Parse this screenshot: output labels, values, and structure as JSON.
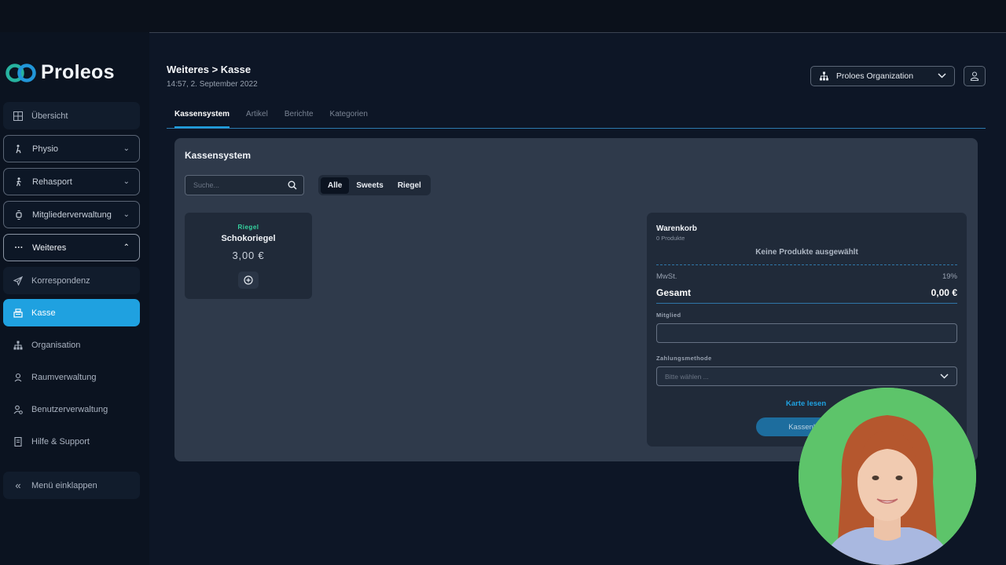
{
  "app": {
    "name": "Proleos"
  },
  "sidebar": {
    "items": [
      {
        "label": "Übersicht",
        "icon": "grid-icon"
      },
      {
        "label": "Physio",
        "icon": "physio-icon"
      },
      {
        "label": "Rehasport",
        "icon": "walking-icon"
      },
      {
        "label": "Mitgliederverwaltung",
        "icon": "watch-icon"
      },
      {
        "label": "Weiteres",
        "icon": "more-icon"
      },
      {
        "label": "Korrespondenz",
        "icon": "send-icon"
      },
      {
        "label": "Kasse",
        "icon": "register-icon"
      },
      {
        "label": "Organisation",
        "icon": "org-icon"
      },
      {
        "label": "Raumverwaltung",
        "icon": "room-icon"
      },
      {
        "label": "Benutzerverwaltung",
        "icon": "users-icon"
      },
      {
        "label": "Hilfe & Support",
        "icon": "help-icon"
      }
    ],
    "collapse_label": "Menü einklappen"
  },
  "header": {
    "breadcrumb": "Weiteres > Kasse",
    "datetime": "14:57, 2. September 2022",
    "organization": "Proloes Organization"
  },
  "tabs": [
    {
      "label": "Kassensystem",
      "active": true
    },
    {
      "label": "Artikel",
      "active": false
    },
    {
      "label": "Berichte",
      "active": false
    },
    {
      "label": "Kategorien",
      "active": false
    }
  ],
  "panel": {
    "title": "Kassensystem",
    "search_placeholder": "Suche...",
    "filters": [
      {
        "label": "Alle",
        "active": true
      },
      {
        "label": "Sweets",
        "active": false
      },
      {
        "label": "Riegel",
        "active": false
      }
    ]
  },
  "products": [
    {
      "category": "Riegel",
      "name": "Schokoriegel",
      "price": "3,00 €"
    }
  ],
  "cart": {
    "title": "Warenkorb",
    "count": "0 Produkte",
    "empty_text": "Keine Produkte ausgewählt",
    "tax_label": "MwSt.",
    "tax_value": "19%",
    "total_label": "Gesamt",
    "total_value": "0,00 €",
    "member_label": "Mitglied",
    "member_value": "",
    "payment_label": "Zahlungsmethode",
    "payment_placeholder": "Bitte wählen ...",
    "card_link": "Karte lesen",
    "receipt_button": "Kassenbon"
  },
  "colors": {
    "accent": "#1fa1e0",
    "background": "#0d1626",
    "panel": "#2f3a4b",
    "category": "#35d6a2"
  }
}
